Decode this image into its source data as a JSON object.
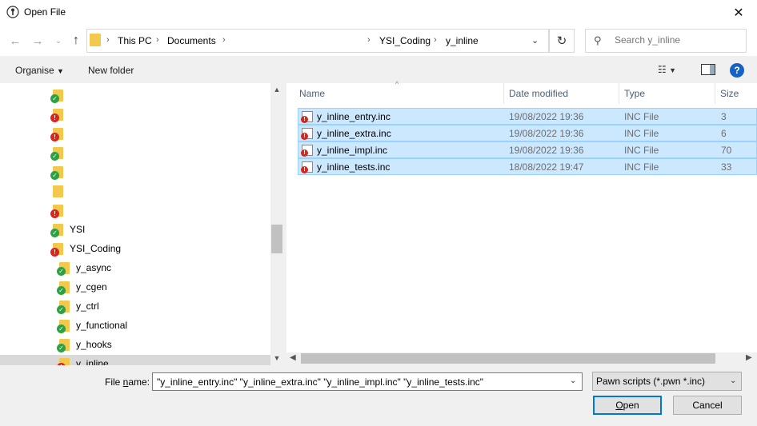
{
  "window": {
    "title": "Open File"
  },
  "address": {
    "crumbs": [
      "This PC",
      "Documents",
      "YSI_Coding",
      "y_inline"
    ],
    "separator": "›"
  },
  "search": {
    "placeholder": "Search y_inline"
  },
  "toolbar": {
    "organise": "Organise",
    "new_folder": "New folder"
  },
  "tree": {
    "items": [
      {
        "label": "",
        "status": "ok"
      },
      {
        "label": "",
        "status": "error"
      },
      {
        "label": "",
        "status": "error"
      },
      {
        "label": "",
        "status": "ok"
      },
      {
        "label": "",
        "status": "ok"
      },
      {
        "label": "",
        "status": "none"
      },
      {
        "label": "",
        "status": "error"
      },
      {
        "label": "YSI",
        "status": "ok"
      },
      {
        "label": "YSI_Coding",
        "status": "error"
      },
      {
        "label": "y_async",
        "status": "ok"
      },
      {
        "label": "y_cgen",
        "status": "ok"
      },
      {
        "label": "y_ctrl",
        "status": "ok"
      },
      {
        "label": "y_functional",
        "status": "ok"
      },
      {
        "label": "y_hooks",
        "status": "ok"
      },
      {
        "label": "y_inline",
        "status": "error",
        "selected": true
      }
    ]
  },
  "columns": {
    "name": "Name",
    "date": "Date modified",
    "type": "Type",
    "size": "Size"
  },
  "files": [
    {
      "name": "y_inline_entry.inc",
      "date": "19/08/2022 19:36",
      "type": "INC File",
      "size": "3"
    },
    {
      "name": "y_inline_extra.inc",
      "date": "19/08/2022 19:36",
      "type": "INC File",
      "size": "6"
    },
    {
      "name": "y_inline_impl.inc",
      "date": "19/08/2022 19:36",
      "type": "INC File",
      "size": "70"
    },
    {
      "name": "y_inline_tests.inc",
      "date": "18/08/2022 19:47",
      "type": "INC File",
      "size": "33"
    }
  ],
  "footer": {
    "file_name_label_pre": "File ",
    "file_name_label_ul": "n",
    "file_name_label_post": "ame:",
    "file_name_value": "\"y_inline_entry.inc\" \"y_inline_extra.inc\" \"y_inline_impl.inc\" \"y_inline_tests.inc\"",
    "filter": "Pawn scripts (*.pwn *.inc)",
    "open_ul": "O",
    "open_rest": "pen",
    "cancel": "Cancel"
  },
  "colors": {
    "selection": "#cce8ff",
    "accent": "#0078d7",
    "folder": "#f2c94c",
    "ok": "#2ea043",
    "error": "#d7261e"
  },
  "icons": {
    "app": "key-icon",
    "close": "close-icon",
    "back": "back-arrow-icon",
    "forward": "forward-arrow-icon",
    "up": "up-arrow-icon",
    "refresh": "refresh-icon",
    "search": "search-icon",
    "help": "help-icon"
  }
}
